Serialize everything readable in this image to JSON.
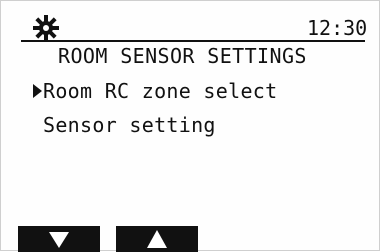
{
  "header": {
    "time": "12:30",
    "title": "ROOM SENSOR SETTINGS",
    "icon": "gear-icon"
  },
  "menu": {
    "items": [
      {
        "label": "Room RC zone select",
        "selected": true
      },
      {
        "label": "Sensor setting",
        "selected": false
      }
    ]
  },
  "softkeys": [
    {
      "icon": "arrow-down-icon"
    },
    {
      "icon": "arrow-up-icon"
    }
  ],
  "colors": {
    "background": "#fefefe",
    "foreground": "#111111"
  }
}
